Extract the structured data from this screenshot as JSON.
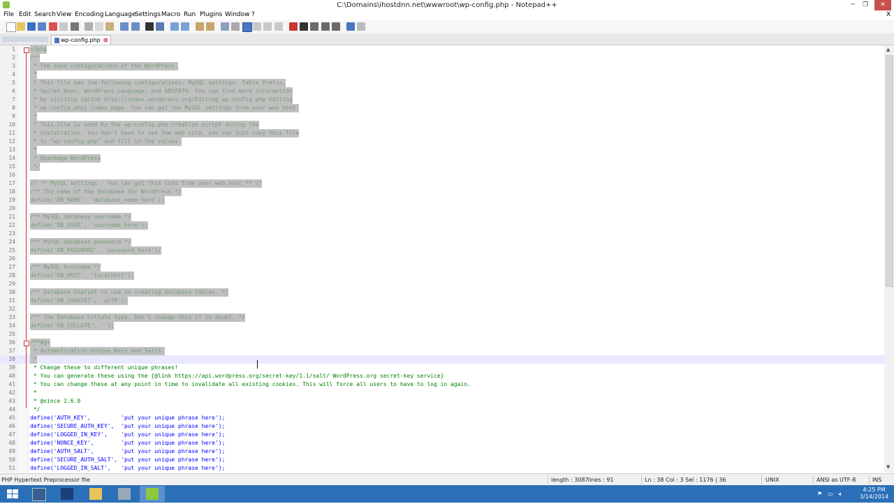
{
  "window": {
    "title": "C:\\Domains\\ihostdnn.net\\wwwroot\\wp-config.php - Notepad++",
    "minimize": "─",
    "maximize": "❐",
    "close": "✕"
  },
  "menu": {
    "items": [
      "File",
      "Edit",
      "Search",
      "View",
      "Encoding",
      "Language",
      "Settings",
      "Macro",
      "Run",
      "Plugins",
      "Window",
      "?"
    ],
    "close_x": "X"
  },
  "tab": {
    "label": "wp-config.php",
    "close": "⊠"
  },
  "editor": {
    "lines": [
      {
        "n": "1",
        "text": "<?php",
        "sel": true
      },
      {
        "n": "2",
        "text": "/**",
        "sel": true
      },
      {
        "n": "3",
        "text": " * The base configurations of the WordPress.",
        "sel": true
      },
      {
        "n": "4",
        "text": " *",
        "sel": true
      },
      {
        "n": "5",
        "text": " * This file has the following configurations: MySQL settings, Table Prefix,",
        "sel": true
      },
      {
        "n": "6",
        "text": " * Secret Keys, WordPress Language, and ABSPATH. You can find more information",
        "sel": true
      },
      {
        "n": "7",
        "text": " * by visiting {@link http://codex.wordpress.org/Editing_wp-config.php Editing",
        "sel": true
      },
      {
        "n": "8",
        "text": " * wp-config.php} Codex page. You can get the MySQL settings from your web host.",
        "sel": true
      },
      {
        "n": "9",
        "text": " *",
        "sel": true
      },
      {
        "n": "10",
        "text": " * This file is used by the wp-config.php creation script during the",
        "sel": true
      },
      {
        "n": "11",
        "text": " * installation. You don't have to use the web site, you can just copy this file",
        "sel": true
      },
      {
        "n": "12",
        "text": " * to \"wp-config.php\" and fill in the values.",
        "sel": true
      },
      {
        "n": "13",
        "text": " *",
        "sel": true
      },
      {
        "n": "14",
        "text": " * @package WordPress",
        "sel": true
      },
      {
        "n": "15",
        "text": " */",
        "sel": true
      },
      {
        "n": "16",
        "text": "",
        "sel": true
      },
      {
        "n": "17",
        "text": "// ** MySQL settings - You can get this info from your web host ** //",
        "sel": true
      },
      {
        "n": "18",
        "text": "/** The name of the database for WordPress */",
        "sel": true
      },
      {
        "n": "19",
        "text": "define('DB_NAME', 'database_name_here');",
        "sel": true
      },
      {
        "n": "20",
        "text": "",
        "sel": true
      },
      {
        "n": "21",
        "text": "/** MySQL database username */",
        "sel": true
      },
      {
        "n": "22",
        "text": "define('DB_USER', 'username_here');",
        "sel": true
      },
      {
        "n": "23",
        "text": "",
        "sel": true
      },
      {
        "n": "24",
        "text": "/** MySQL database password */",
        "sel": true
      },
      {
        "n": "25",
        "text": "define('DB_PASSWORD', 'password_here');",
        "sel": true
      },
      {
        "n": "26",
        "text": "",
        "sel": true
      },
      {
        "n": "27",
        "text": "/** MySQL hostname */",
        "sel": true
      },
      {
        "n": "28",
        "text": "define('DB_HOST', 'localhost');",
        "sel": true
      },
      {
        "n": "29",
        "text": "",
        "sel": true
      },
      {
        "n": "30",
        "text": "/** Database Charset to use in creating database tables. */",
        "sel": true
      },
      {
        "n": "31",
        "text": "define('DB_CHARSET', 'utf8');",
        "sel": true
      },
      {
        "n": "32",
        "text": "",
        "sel": true
      },
      {
        "n": "33",
        "text": "/** The Database Collate type. Don't change this if in doubt. */",
        "sel": true
      },
      {
        "n": "34",
        "text": "define('DB_COLLATE', '');",
        "sel": true
      },
      {
        "n": "35",
        "text": "",
        "sel": true
      },
      {
        "n": "36",
        "text": "/**#@+",
        "sel": true
      },
      {
        "n": "37",
        "text": " * Authentication Unique Keys and Salts.",
        "sel": true
      },
      {
        "n": "38",
        "text": " *",
        "sel": true
      },
      {
        "n": "39",
        "text": " * Change these to different unique phrases!",
        "sel": false
      },
      {
        "n": "40",
        "text": " * You can generate these using the {@link https://api.wordpress.org/secret-key/1.1/salt/ WordPress.org secret-key service}",
        "sel": false
      },
      {
        "n": "41",
        "text": " * You can change these at any point in time to invalidate all existing cookies. This will force all users to have to log in again.",
        "sel": false
      },
      {
        "n": "42",
        "text": " *",
        "sel": false
      },
      {
        "n": "43",
        "text": " * @since 2.6.0",
        "sel": false
      },
      {
        "n": "44",
        "text": " */",
        "sel": false
      },
      {
        "n": "45",
        "text": "define('AUTH_KEY',         'put your unique phrase here');",
        "sel": false
      },
      {
        "n": "46",
        "text": "define('SECURE_AUTH_KEY',  'put your unique phrase here');",
        "sel": false
      },
      {
        "n": "47",
        "text": "define('LOGGED_IN_KEY',    'put your unique phrase here');",
        "sel": false
      },
      {
        "n": "48",
        "text": "define('NONCE_KEY',        'put your unique phrase here');",
        "sel": false
      },
      {
        "n": "49",
        "text": "define('AUTH_SALT',        'put your unique phrase here');",
        "sel": false
      },
      {
        "n": "50",
        "text": "define('SECURE_AUTH_SALT', 'put your unique phrase here');",
        "sel": false
      },
      {
        "n": "51",
        "text": "define('LOGGED_IN_SALT',   'put your unique phrase here');",
        "sel": false
      }
    ]
  },
  "statusbar": {
    "filetype": "PHP Hypertext Preprocessor file",
    "length": "length : 3087",
    "lines": "lines : 91",
    "position": "Ln : 38   Col : 3   Sel : 1176 | 36",
    "eol": "UNIX",
    "encoding": "ANSI as UTF-8",
    "mode": "INS"
  },
  "taskbar": {
    "time": "4:25 PM",
    "date": "3/14/2014"
  },
  "colors": {
    "accent": "#2b6fb8",
    "selection": "#c0c0c0",
    "comment": "#008000",
    "keyword": "#0000ff"
  }
}
